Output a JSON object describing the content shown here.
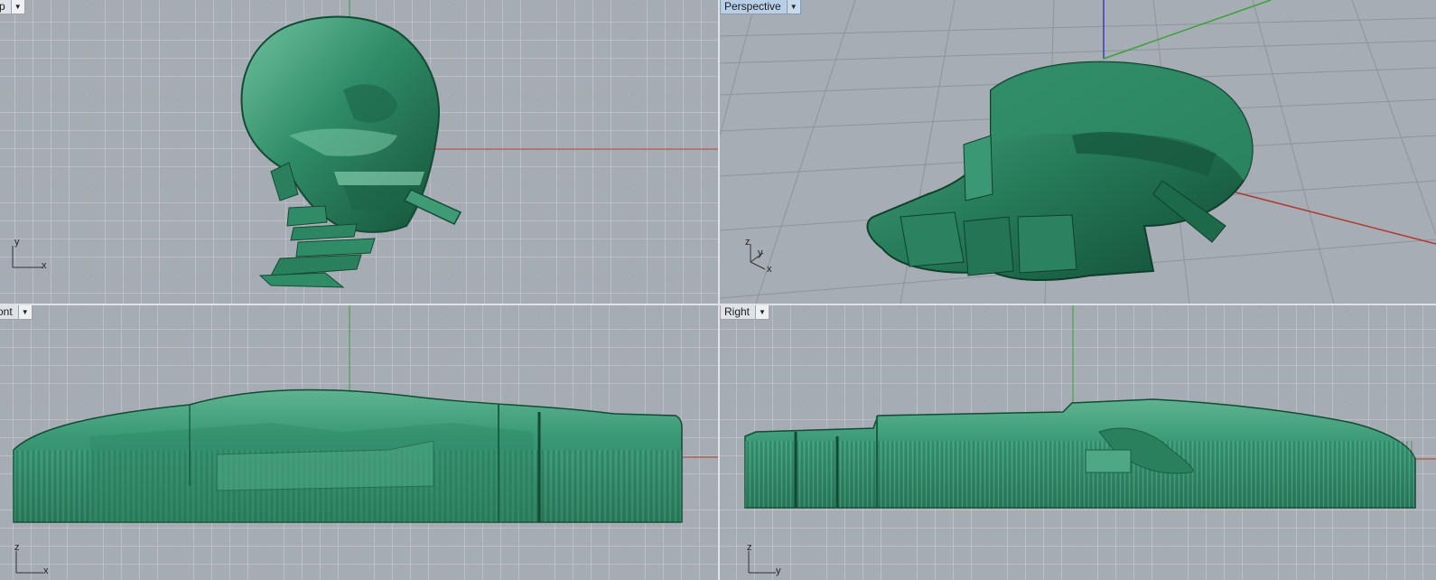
{
  "viewports": {
    "top": {
      "title": "Top",
      "title_visible": "p",
      "axes": {
        "a": "y",
        "b": "x"
      }
    },
    "perspective": {
      "title": "Perspective",
      "axes": {
        "a": "z",
        "b": "y",
        "c": "x"
      }
    },
    "front": {
      "title": "Front",
      "title_visible": "ont",
      "axes": {
        "a": "z",
        "b": "x"
      }
    },
    "right": {
      "title": "Right",
      "axes": {
        "a": "z",
        "b": "y"
      }
    }
  },
  "dropdown_glyph": "▼",
  "colors": {
    "model_green": "#2e8a66",
    "model_dark": "#1a5e43",
    "model_light": "#5fb592",
    "axis_red": "#b03a2e",
    "axis_green": "#3aa13a",
    "axis_blue": "#3a3ab8",
    "active_title": "#b9cfe8"
  }
}
